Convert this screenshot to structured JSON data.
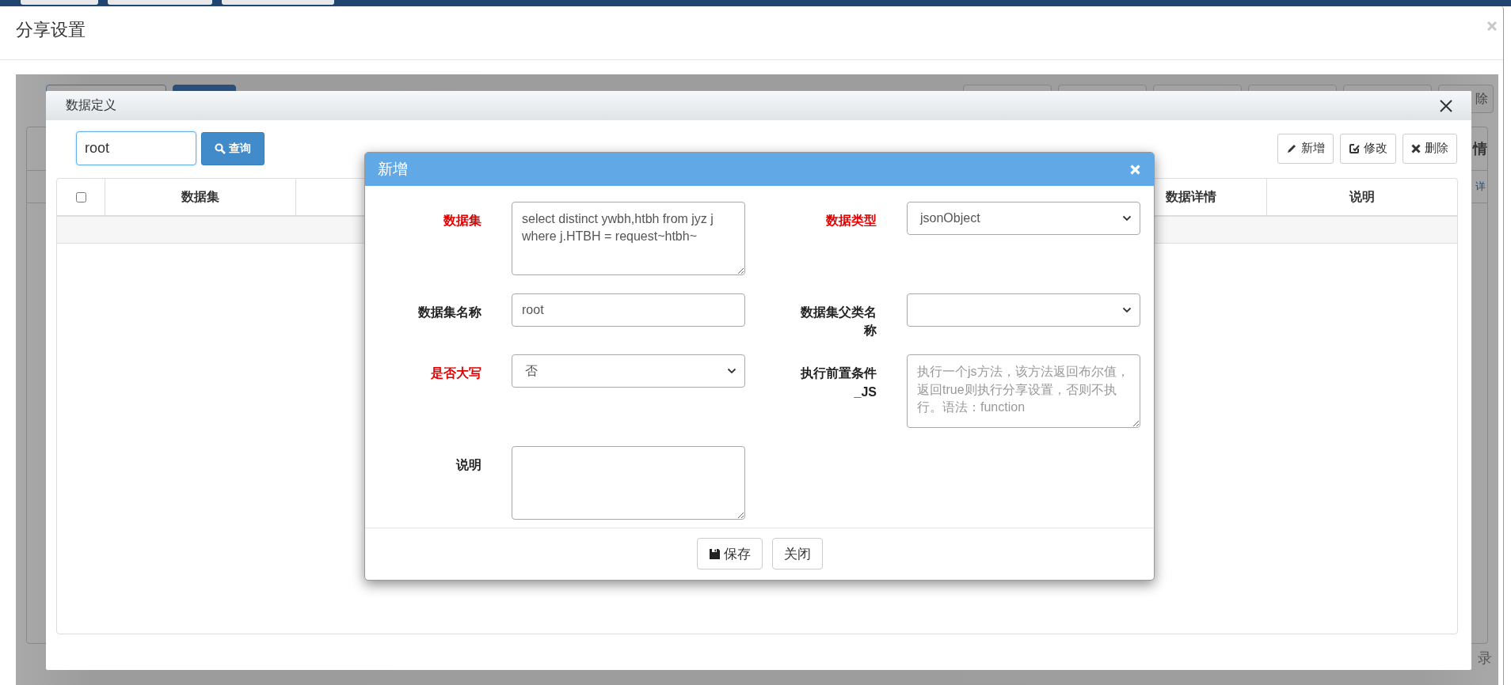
{
  "share_dialog": {
    "title": "分享设置"
  },
  "background_page": {
    "toolbar_text": "除",
    "column_text": "情",
    "link_text": "详",
    "footer_text": "录"
  },
  "data_dialog": {
    "title": "数据定义",
    "search": {
      "value": "root"
    },
    "search_button": "查询",
    "toolbar": [
      {
        "kind": "add",
        "label": "新增"
      },
      {
        "kind": "edit",
        "label": "修改"
      },
      {
        "kind": "delete",
        "label": "删除"
      }
    ],
    "table": {
      "select_all": {
        "checked": false
      },
      "columns": [
        {
          "label": "数据集",
          "kind": "left"
        },
        {
          "label": "数据详情",
          "kind": "right"
        },
        {
          "label": "说明",
          "kind": "right"
        }
      ]
    }
  },
  "new_dialog": {
    "title": "新增",
    "fields": [
      {
        "label": "数据集",
        "required": true,
        "kind": "textarea",
        "value": "select distinct ywbh,htbh from jyz j where j.HTBH = request~htbh~"
      },
      {
        "label": "数据类型",
        "required": true,
        "kind": "select",
        "value": "jsonObject"
      },
      {
        "label": "数据集名称",
        "required": false,
        "kind": "input",
        "value": "root"
      },
      {
        "label": "数据集父类名称",
        "required": false,
        "kind": "select"
      },
      {
        "label": "是否大写",
        "required": true,
        "kind": "select",
        "value": "否"
      },
      {
        "label": "执行前置条件_JS",
        "required": false,
        "kind": "textarea",
        "placeholder": "执行一个js方法，该方法返回布尔值，返回true则执行分享设置，否则不执行。语法：function"
      },
      {
        "label": "说明",
        "required": false,
        "kind": "textarea"
      }
    ],
    "buttons": [
      {
        "kind": "save",
        "label": "保存"
      },
      {
        "kind": "close",
        "label": "关闭"
      }
    ]
  }
}
